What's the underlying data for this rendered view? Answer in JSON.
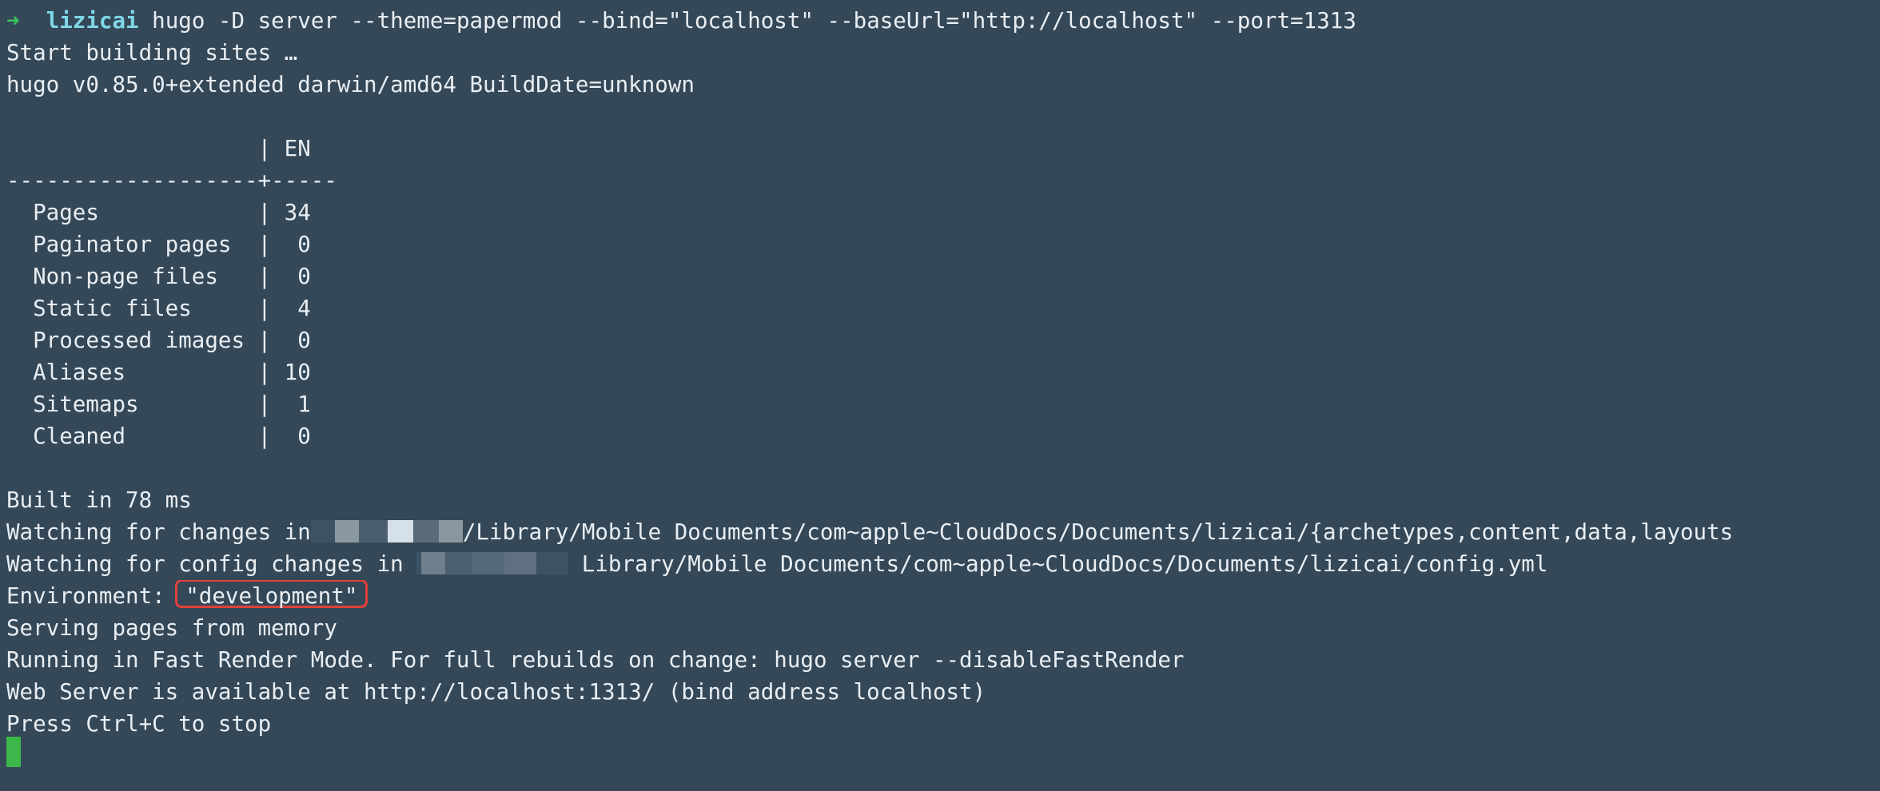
{
  "terminal": {
    "prompt_arrow": "➜",
    "prompt_user": "lizicai",
    "command": " hugo -D server --theme=papermod --bind=\"localhost\" --baseUrl=\"http://localhost\" --port=1313",
    "lines_top": [
      "Start building sites …",
      "hugo v0.85.0+extended darwin/amd64 BuildDate=unknown",
      "",
      "                   | EN",
      "-------------------+-----",
      "  Pages            | 34",
      "  Paginator pages  |  0",
      "  Non-page files   |  0",
      "  Static files     |  4",
      "  Processed images |  0",
      "  Aliases          | 10",
      "  Sitemaps         |  1",
      "  Cleaned          |  0",
      "",
      "Built in 78 ms"
    ],
    "watch_changes_prefix": "Watching for changes in",
    "watch_changes_suffix": "/Library/Mobile Documents/com~apple~CloudDocs/Documents/lizicai/{archetypes,content,data,layouts",
    "watch_config_prefix": "Watching for config changes in ",
    "watch_config_suffix": " Library/Mobile Documents/com~apple~CloudDocs/Documents/lizicai/config.yml",
    "environment_label": "Environment: ",
    "environment_value": "\"development\"",
    "lines_bottom": [
      "Serving pages from memory",
      "Running in Fast Render Mode. For full rebuilds on change: hugo server --disableFastRender",
      "Web Server is available at http://localhost:1313/ (bind address localhost)",
      "Press Ctrl+C to stop"
    ],
    "colors": {
      "background": "#344858",
      "text": "#e9eef2",
      "prompt_arrow": "#38c65a",
      "prompt_user": "#7fd8e8",
      "highlight_border": "#e0413a",
      "cursor": "#3cb84a"
    }
  }
}
